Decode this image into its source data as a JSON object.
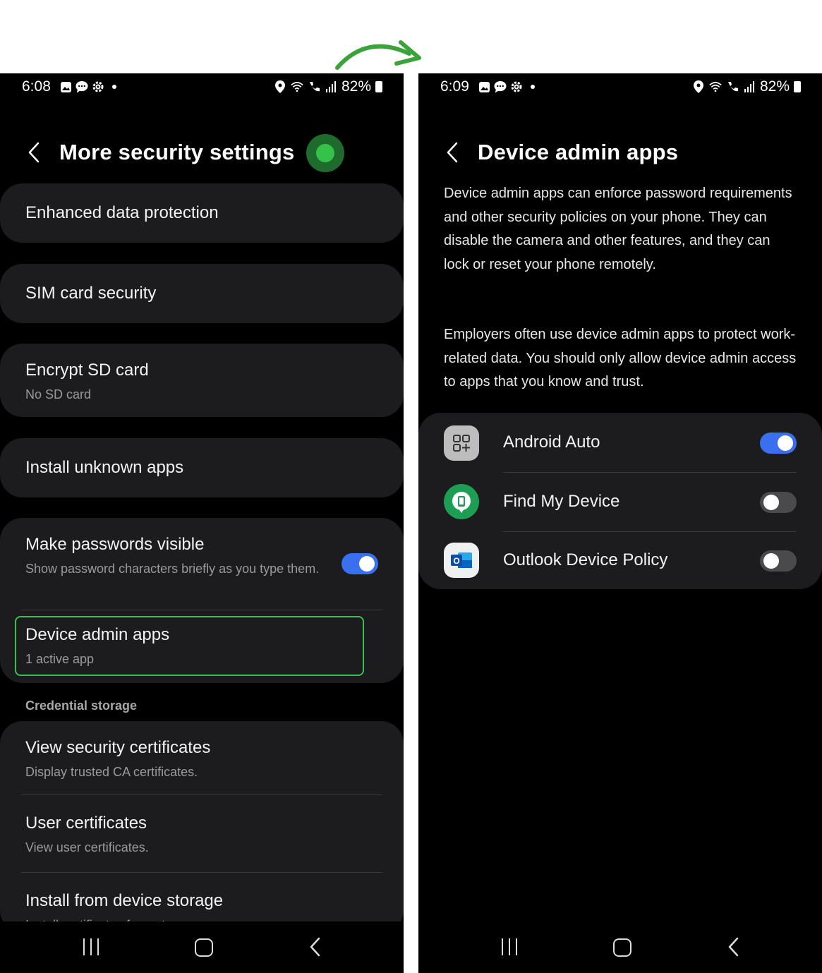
{
  "left_screen": {
    "status": {
      "time": "6:08",
      "battery": "82%"
    },
    "title": "More security settings",
    "items": [
      {
        "title": "Enhanced data protection"
      },
      {
        "title": "SIM card security"
      },
      {
        "title": "Encrypt SD card",
        "subtitle": "No SD card"
      },
      {
        "title": "Install unknown apps"
      },
      {
        "title": "Make passwords visible",
        "subtitle": "Show password characters briefly as you type them.",
        "toggle": "on"
      },
      {
        "title": "Device admin apps",
        "subtitle": "1 active app"
      }
    ],
    "section_label": "Credential storage",
    "credential_items": [
      {
        "title": "View security certificates",
        "subtitle": "Display trusted CA certificates."
      },
      {
        "title": "User certificates",
        "subtitle": "View user certificates."
      },
      {
        "title": "Install from device storage",
        "subtitle": "Install certificates from storage"
      }
    ]
  },
  "right_screen": {
    "status": {
      "time": "6:09",
      "battery": "82%"
    },
    "title": "Device admin apps",
    "description_1": "Device admin apps can enforce password requirements and other security policies on your phone. They can disable the camera and other features, and they can lock or reset your phone remotely.",
    "description_2": "Employers often use device admin apps to protect work-related data. You should only allow device admin access to apps that you know and trust.",
    "apps": [
      {
        "name": "Android Auto",
        "toggle": "on",
        "icon": "android-auto-icon"
      },
      {
        "name": "Find My Device",
        "toggle": "off",
        "icon": "find-my-device-icon"
      },
      {
        "name": "Outlook Device Policy",
        "toggle": "off",
        "icon": "outlook-icon"
      }
    ]
  },
  "colors": {
    "accent": "#3a6ff0",
    "highlight": "#34c24a",
    "card": "#1c1c1e"
  }
}
